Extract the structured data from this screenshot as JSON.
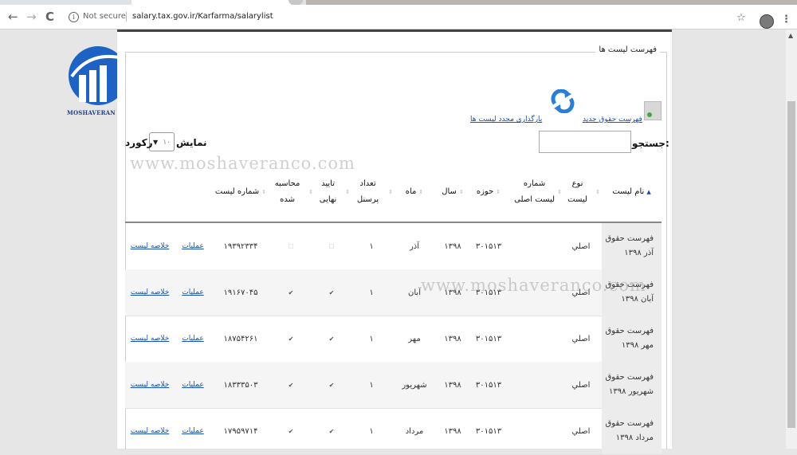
{
  "browser": {
    "security_label": "Not secure",
    "url": "salary.tax.gov.ir/Karfarma/salarylist",
    "back_glyph": "←",
    "forward_glyph": "→",
    "reload_glyph": "C",
    "star_glyph": "☆",
    "menu_glyph": "⋮"
  },
  "logo": {
    "text": "MOSHAVERAN co"
  },
  "watermarks": [
    "www.moshaveranco.com",
    "www.moshaveranco.com"
  ],
  "panel": {
    "legend": "فهرست لیست ها",
    "new_list_link": "فهرست حقوق جدید",
    "reload_lists_link": "بارگذاری مجدد لیست ها",
    "search_label": "جستجو:",
    "show_label": "نمایش",
    "records_label": "رکورد",
    "page_size_value": "۱۰"
  },
  "table": {
    "columns": [
      "نام لیست",
      "نوع لیست",
      "شماره لیست اصلی",
      "حوزه",
      "سال",
      "ماه",
      "تعداد پرسنل",
      "تایید نهایی",
      "محاسبه شده",
      "شماره لیست",
      ""
    ],
    "rows": [
      {
        "name": "فهرست حقوق آذر ۱۳۹۸",
        "type": "اصلي",
        "main_no": "",
        "zone": "۳۰۱۵۱۳",
        "year": "۱۳۹۸",
        "month": "آذر",
        "personnel": "۱",
        "final": false,
        "computed": false,
        "list_no": "۱۹۳۹۲۳۳۴",
        "link1": "عملیات",
        "link2": "خلاصه لیست"
      },
      {
        "name": "فهرست حقوق آبان ۱۳۹۸",
        "type": "اصلي",
        "main_no": "",
        "zone": "۳۰۱۵۱۳",
        "year": "۱۳۹۸",
        "month": "آبان",
        "personnel": "۱",
        "final": true,
        "computed": true,
        "list_no": "۱۹۱۶۷۰۴۵",
        "link1": "عملیات",
        "link2": "خلاصه لیست"
      },
      {
        "name": "فهرست حقوق مهر ۱۳۹۸",
        "type": "اصلي",
        "main_no": "",
        "zone": "۳۰۱۵۱۳",
        "year": "۱۳۹۸",
        "month": "مهر",
        "personnel": "۱",
        "final": true,
        "computed": true,
        "list_no": "۱۸۷۵۴۲۶۱",
        "link1": "عملیات",
        "link2": "خلاصه لیست"
      },
      {
        "name": "فهرست حقوق شهریور ۱۳۹۸",
        "type": "اصلي",
        "main_no": "",
        "zone": "۳۰۱۵۱۳",
        "year": "۱۳۹۸",
        "month": "شهریور",
        "personnel": "۱",
        "final": true,
        "computed": true,
        "list_no": "۱۸۳۳۳۵۰۳",
        "link1": "عملیات",
        "link2": "خلاصه لیست"
      },
      {
        "name": "فهرست حقوق مرداد ۱۳۹۸",
        "type": "اصلي",
        "main_no": "",
        "zone": "۳۰۱۵۱۳",
        "year": "۱۳۹۸",
        "month": "مرداد",
        "personnel": "۱",
        "final": true,
        "computed": true,
        "list_no": "۱۷۹۵۹۷۱۴",
        "link1": "عملیات",
        "link2": "خلاصه لیست"
      }
    ]
  },
  "colors": {
    "link": "#1a4fb4",
    "logo_blue": "#1e63c4",
    "accent_green": "#3caa3c"
  }
}
